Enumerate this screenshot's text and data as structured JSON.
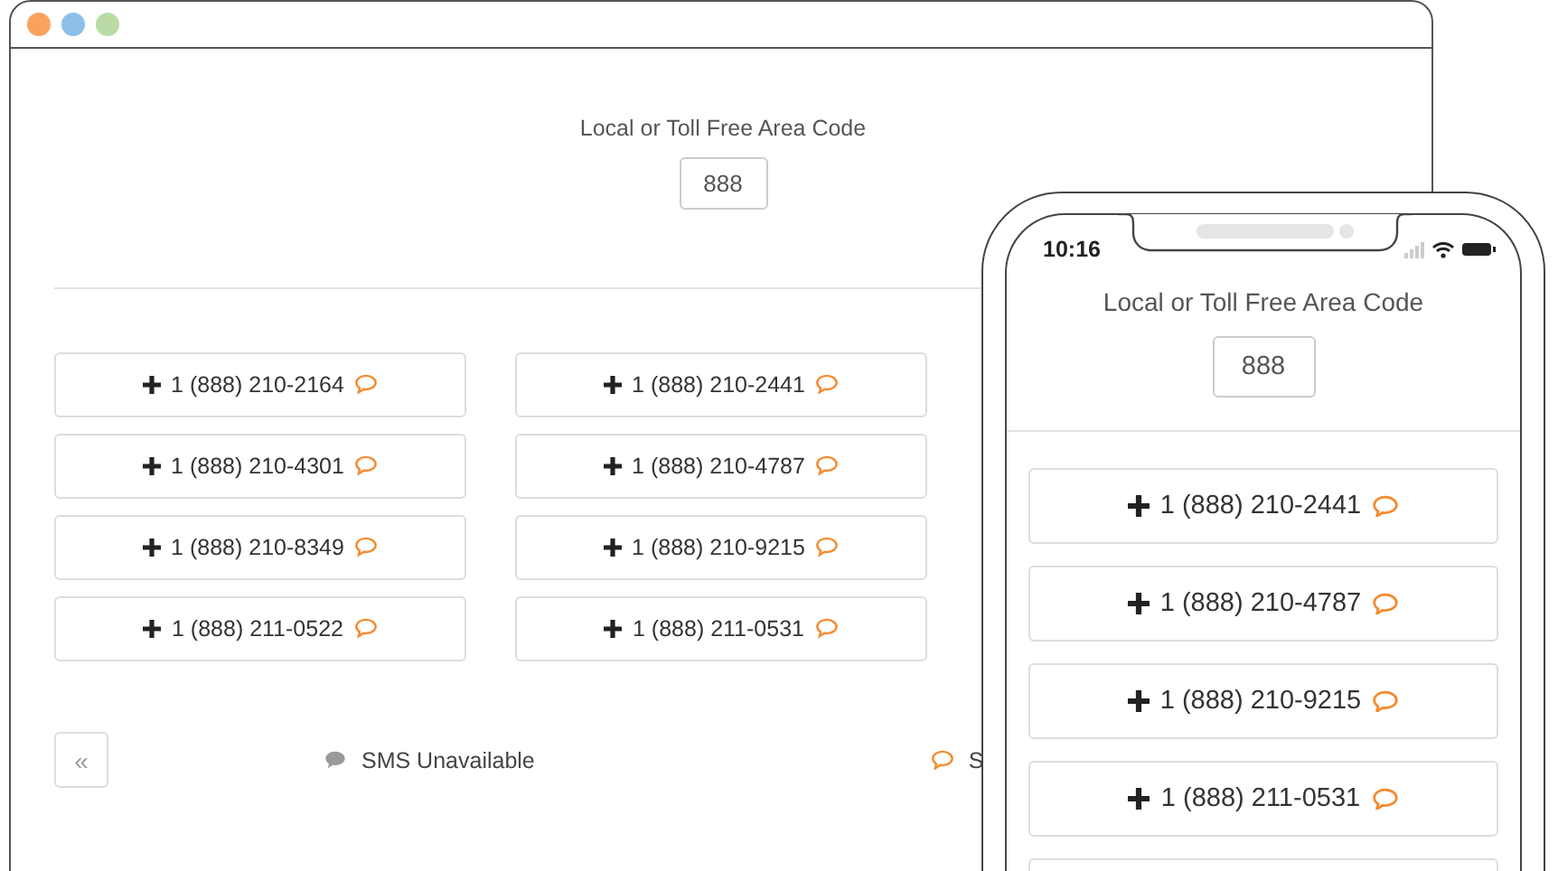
{
  "desktop": {
    "area_code": {
      "label": "Local or Toll Free Area Code",
      "value": "888"
    },
    "numbers": [
      {
        "label": "1 (888) 210-2164",
        "sms": true
      },
      {
        "label": "1 (888) 210-2441",
        "sms": true
      },
      {
        "label": "1 (888) 210-4301",
        "sms": true
      },
      {
        "label": "1 (888) 210-4787",
        "sms": true
      },
      {
        "label": "1 (888) 210-8349",
        "sms": true
      },
      {
        "label": "1 (888) 210-9215",
        "sms": true
      },
      {
        "label": "1 (888) 211-0522",
        "sms": true
      },
      {
        "label": "1 (888) 211-0531",
        "sms": true
      }
    ],
    "pagination": {
      "previous": "«"
    },
    "legend": [
      {
        "kind": "unavailable",
        "label": "SMS Unavailable"
      },
      {
        "kind": "available",
        "label": "S"
      }
    ]
  },
  "phone": {
    "time": "10:16",
    "area_code": {
      "label": "Local or Toll Free Area Code",
      "value": "888"
    },
    "numbers": [
      {
        "label": "1 (888) 210-2441",
        "sms": true
      },
      {
        "label": "1 (888) 210-4787",
        "sms": true
      },
      {
        "label": "1 (888) 210-9215",
        "sms": true
      },
      {
        "label": "1 (888) 211-0531",
        "sms": true
      }
    ]
  }
}
